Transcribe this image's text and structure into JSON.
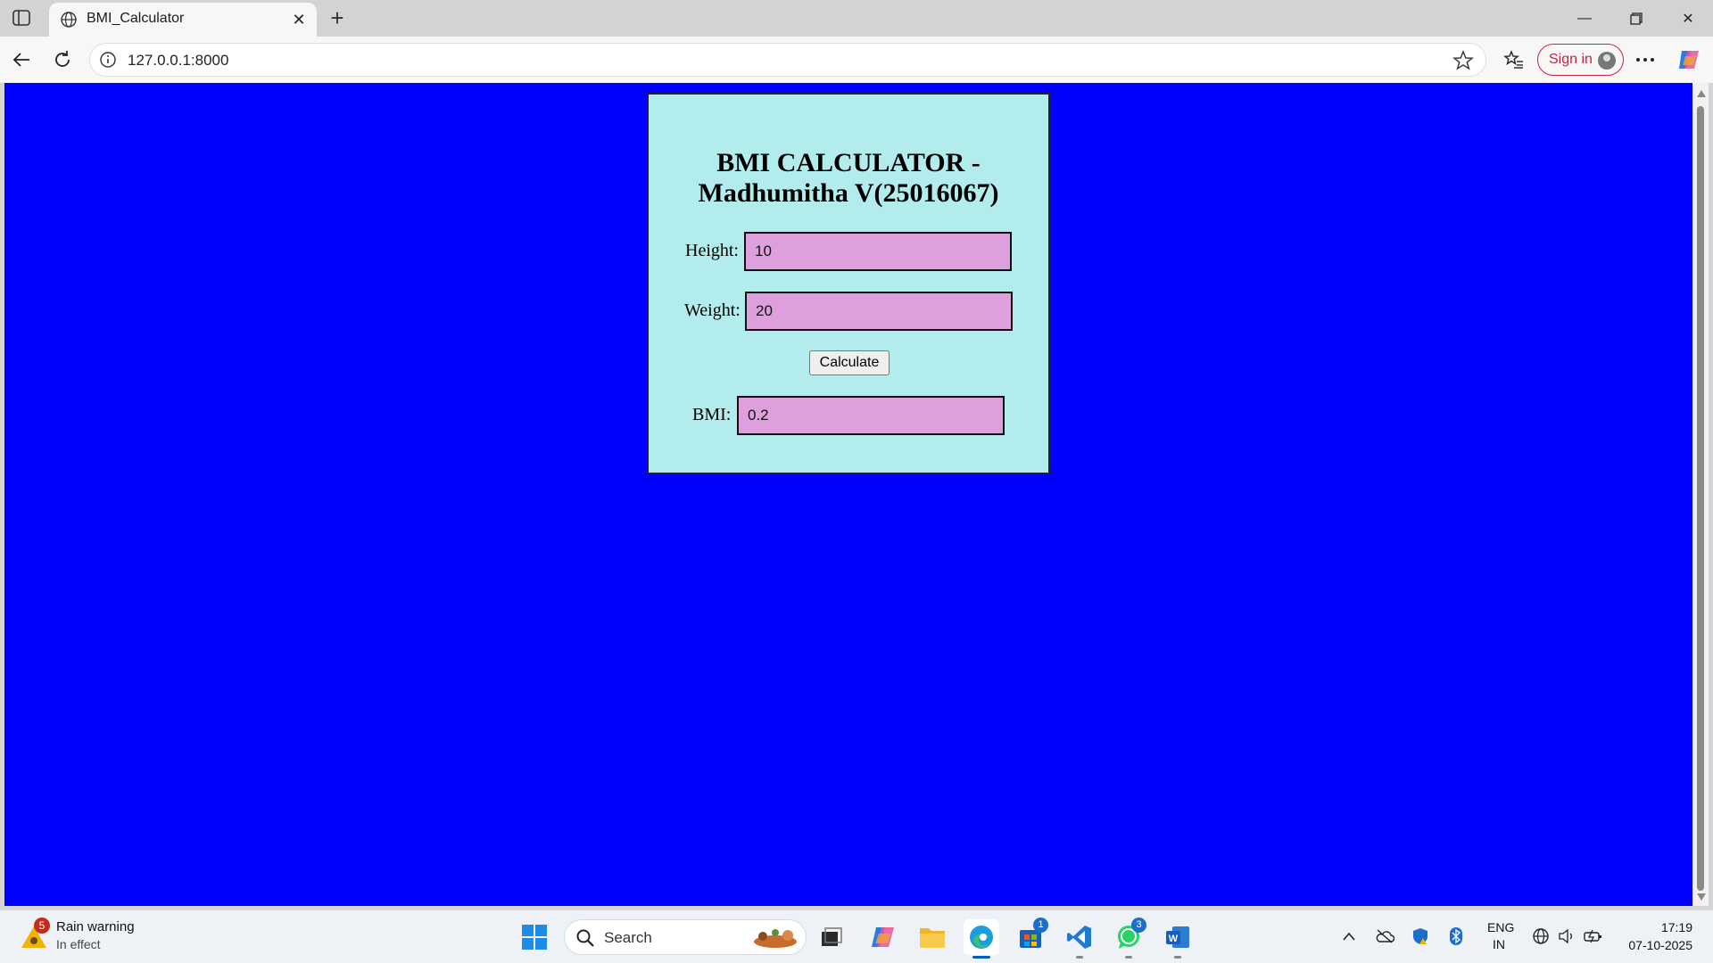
{
  "browser": {
    "tab_title": "BMI_Calculator",
    "url": "127.0.0.1:8000",
    "sign_in_label": "Sign in"
  },
  "page": {
    "heading": "BMI CALCULATOR - Madhumitha V(25016067)",
    "background_color": "#0000ff",
    "card_color": "#b2ecec",
    "input_color": "#dda0dd",
    "height_label": "Height:",
    "height_value": "10",
    "weight_label": "Weight:",
    "weight_value": "20",
    "calculate_label": "Calculate",
    "bmi_label": "BMI:",
    "bmi_value": "0.2"
  },
  "taskbar": {
    "weather_title": "Rain warning",
    "weather_subtitle": "In effect",
    "weather_badge": "5",
    "search_label": "Search",
    "store_badge": "1",
    "whatsapp_badge": "3",
    "lang_line1": "ENG",
    "lang_line2": "IN",
    "time": "17:19",
    "date": "07-10-2025"
  }
}
